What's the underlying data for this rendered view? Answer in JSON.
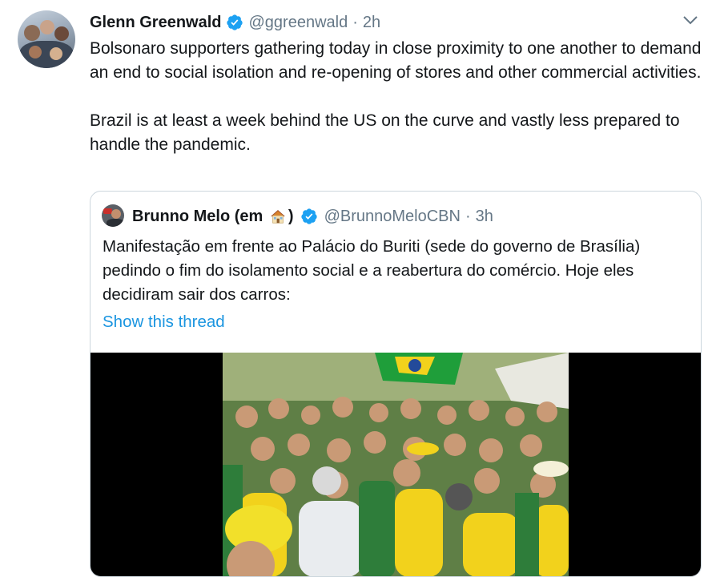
{
  "tweet": {
    "author_name": "Glenn Greenwald",
    "handle": "@ggreenwald",
    "separator": "·",
    "time": "2h",
    "text": "Bolsonaro supporters gathering today in close proximity to one another to demand an end to social isolation and re-opening of stores and other commercial activities.\n\nBrazil is at least a week behind the US on the curve and vastly less prepared to handle the pandemic."
  },
  "quote": {
    "author_name_prefix": "Brunno Melo (em",
    "author_name_suffix": ")",
    "handle": "@BrunnoMeloCBN",
    "separator": "·",
    "time": "3h",
    "text": "Manifestação em frente ao Palácio do Buriti (sede do governo de Brasília) pedindo o fim do isolamento social e a reabertura do comércio. Hoje eles decidiram sair dos carros:",
    "show_thread": "Show this thread"
  },
  "icons": {
    "verified": "verified-badge-icon",
    "chevron": "chevron-down-icon",
    "house": "house-emoji-icon"
  },
  "colors": {
    "link": "#1b95e0",
    "verified": "#1da1f2",
    "muted": "#657786",
    "border": "#ccd6dd"
  }
}
